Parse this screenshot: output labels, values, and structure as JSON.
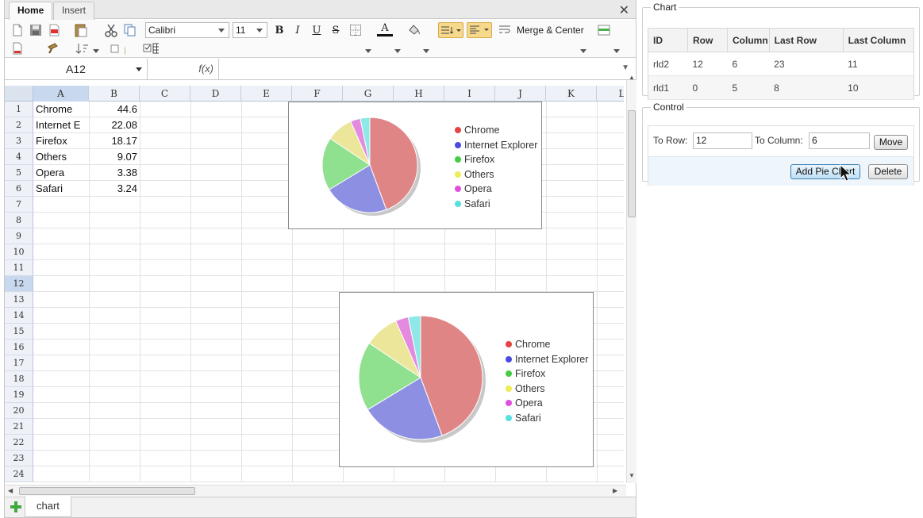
{
  "ribbon": {
    "tabs": [
      {
        "label": "Home",
        "active": true
      },
      {
        "label": "Insert",
        "active": false
      }
    ],
    "close_label": "✕"
  },
  "toolbar": {
    "font_name": "Calibri",
    "font_size": "11",
    "bold": "B",
    "italic": "I",
    "underline": "U",
    "strike": "S",
    "font_color_glyph": "A",
    "merge_label": "Merge & Center"
  },
  "formula_bar": {
    "name_box": "A12",
    "fx_label": "f(x)",
    "formula": ""
  },
  "grid": {
    "columns": [
      "A",
      "B",
      "C",
      "D",
      "E",
      "F",
      "G",
      "H",
      "I",
      "J",
      "K",
      "L"
    ],
    "rows": [
      "1",
      "2",
      "3",
      "4",
      "5",
      "6",
      "7",
      "8",
      "9",
      "10",
      "11",
      "12",
      "13",
      "14",
      "15",
      "16",
      "17",
      "18",
      "19",
      "20",
      "21",
      "22",
      "23",
      "24"
    ],
    "selected_column": "A",
    "selected_row": "12",
    "data": [
      {
        "a": "Chrome",
        "b": "44.6"
      },
      {
        "a": "Internet E",
        "b": "22.08"
      },
      {
        "a": "Firefox",
        "b": "18.17"
      },
      {
        "a": "Others",
        "b": "9.07"
      },
      {
        "a": "Opera",
        "b": "3.38"
      },
      {
        "a": "Safari",
        "b": "3.24"
      }
    ]
  },
  "chart_data": [
    {
      "type": "pie",
      "id": "rld1",
      "categories": [
        "Chrome",
        "Internet Explorer",
        "Firefox",
        "Others",
        "Opera",
        "Safari"
      ],
      "values": [
        44.6,
        22.08,
        18.17,
        9.07,
        3.38,
        3.24
      ],
      "colors": [
        "#e08585",
        "#8d8fe2",
        "#8fe08f",
        "#ebe69a",
        "#e48be0",
        "#8ee8e8"
      ],
      "legend": "right"
    },
    {
      "type": "pie",
      "id": "rld2",
      "categories": [
        "Chrome",
        "Internet Explorer",
        "Firefox",
        "Others",
        "Opera",
        "Safari"
      ],
      "values": [
        44.6,
        22.08,
        18.17,
        9.07,
        3.38,
        3.24
      ],
      "colors": [
        "#e08585",
        "#8d8fe2",
        "#8fe08f",
        "#ebe69a",
        "#e48be0",
        "#8ee8e8"
      ],
      "legend": "right"
    }
  ],
  "legend_dot_colors": [
    "#e64444",
    "#4a4ae0",
    "#44cc44",
    "#eded55",
    "#e050e0",
    "#55e0e0"
  ],
  "sheet_tabs": {
    "active": "chart"
  },
  "chart_panel": {
    "legend": "Chart",
    "headers": [
      "ID",
      "Row",
      "Column",
      "Last Row",
      "Last Column"
    ],
    "rows": [
      [
        "rld2",
        "12",
        "6",
        "23",
        "11"
      ],
      [
        "rld1",
        "0",
        "5",
        "8",
        "10"
      ]
    ]
  },
  "control_panel": {
    "legend": "Control",
    "to_row_label": "To Row:",
    "to_row_value": "12",
    "to_column_label": "To Column:",
    "to_column_value": "6",
    "move_label": "Move",
    "add_pie_chart_label": "Add Pie Chart",
    "delete_label": "Delete"
  }
}
